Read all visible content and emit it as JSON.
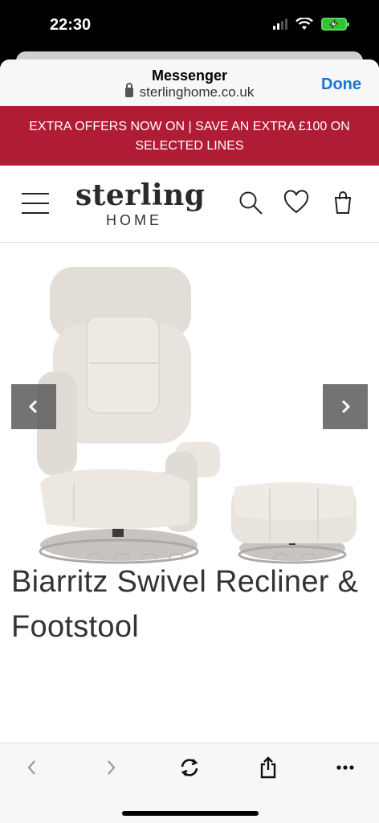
{
  "status": {
    "time": "22:30"
  },
  "browser": {
    "title": "Messenger",
    "url": "sterlinghome.co.uk",
    "done_label": "Done"
  },
  "promo": {
    "text": "EXTRA OFFERS NOW ON | SAVE AN EXTRA £100 ON SELECTED LINES"
  },
  "site": {
    "logo_word": "sterling",
    "logo_sub": "HOME"
  },
  "product": {
    "title": "Biarritz Swivel Recliner & Footstool"
  },
  "icons": {
    "menu": "hamburger-icon",
    "search": "search-icon",
    "wishlist": "heart-icon",
    "bag": "shopping-bag-icon",
    "prev": "chevron-left-icon",
    "next": "chevron-right-icon",
    "refresh": "refresh-icon",
    "share": "share-icon",
    "more": "more-icon"
  },
  "colors": {
    "promo_bg": "#b01c33",
    "done": "#1a73d9",
    "battery": "#33c233"
  }
}
